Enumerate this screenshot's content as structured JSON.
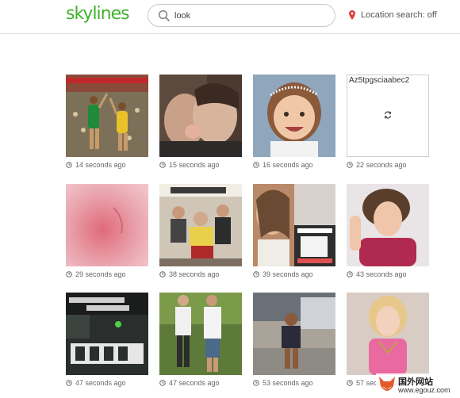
{
  "header": {
    "logo": "skylines",
    "search": {
      "value": "look",
      "placeholder": ""
    },
    "location": {
      "label": "Location search: off"
    }
  },
  "colors": {
    "brand": "#3fb22c",
    "pin": "#d9453a"
  },
  "feed": {
    "items": [
      {
        "time": "14 seconds ago",
        "image": "basketball-players"
      },
      {
        "time": "15 seconds ago",
        "image": "couple-closeup"
      },
      {
        "time": "16 seconds ago",
        "image": "smiling-child"
      },
      {
        "time": "22 seconds ago",
        "image": "loading-placeholder",
        "code": "Az5tpgsciaabec2"
      },
      {
        "time": "29 seconds ago",
        "image": "blurry-skin-closeup"
      },
      {
        "time": "38 seconds ago",
        "image": "band-poster"
      },
      {
        "time": "39 seconds ago",
        "image": "back-to-school-ad"
      },
      {
        "time": "43 seconds ago",
        "image": "curly-haired-man"
      },
      {
        "time": "47 seconds ago",
        "image": "game-screen"
      },
      {
        "time": "47 seconds ago",
        "image": "people-outdoors"
      },
      {
        "time": "53 seconds ago",
        "image": "child-in-garage"
      },
      {
        "time": "57 seconds ago",
        "image": "woman-in-pink"
      }
    ]
  },
  "watermark": {
    "cn": "国外网站",
    "url": "www.egouz.com"
  }
}
